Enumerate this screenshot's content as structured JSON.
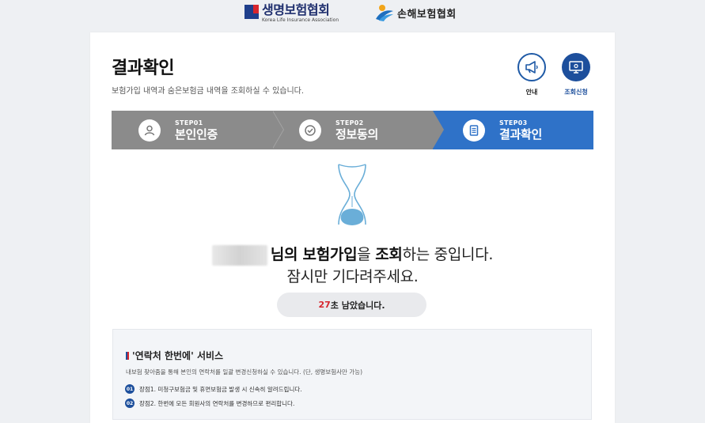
{
  "header": {
    "life_logo_ko": "생명보험협회",
    "life_logo_en": "Korea Life Insurance Association",
    "general_logo_ko": "손해보험협회"
  },
  "page": {
    "title": "결과확인",
    "subtitle": "보험가입 내역과 숨은보험금 내역을 조회하실 수 있습니다."
  },
  "quick": [
    {
      "label": "안내",
      "icon": "megaphone-icon"
    },
    {
      "label": "조회신청",
      "icon": "monitor-icon"
    }
  ],
  "steps": [
    {
      "num": "STEP01",
      "name": "본인인증",
      "icon": "user-icon",
      "active": false
    },
    {
      "num": "STEP02",
      "name": "정보동의",
      "icon": "check-icon",
      "active": false
    },
    {
      "num": "STEP03",
      "name": "결과확인",
      "icon": "document-icon",
      "active": true
    }
  ],
  "status": {
    "suffix_1": "님의 ",
    "bold_1": "보험가입",
    "mid_1": "을 ",
    "bold_2": "조회",
    "end_1": "하는 중입니다.",
    "line_2": "잠시만 기다려주세요."
  },
  "timer": {
    "seconds": "27",
    "suffix": "초 남았습니다."
  },
  "service": {
    "title": "'연락처 한번에' 서비스",
    "description": "내보험 찾아줌을 통해 본인의 연락처를 일괄 변경신청하실 수 있습니다. (단, 생명보험사만 가능)",
    "items": [
      {
        "num": "01",
        "text": "장점1. 미청구보험금 및 휴면보험금 발생 시 신속히 알려드립니다."
      },
      {
        "num": "02",
        "text": "장점2. 한번에 모든 회원사의 연락처를 변경하므로 편리합니다."
      }
    ]
  },
  "colors": {
    "primary": "#1d4f9c",
    "step_active": "#2f72c8",
    "step_inactive": "#8b8b8b",
    "accent_red": "#d7262e",
    "hourglass": "#6aaed8"
  }
}
